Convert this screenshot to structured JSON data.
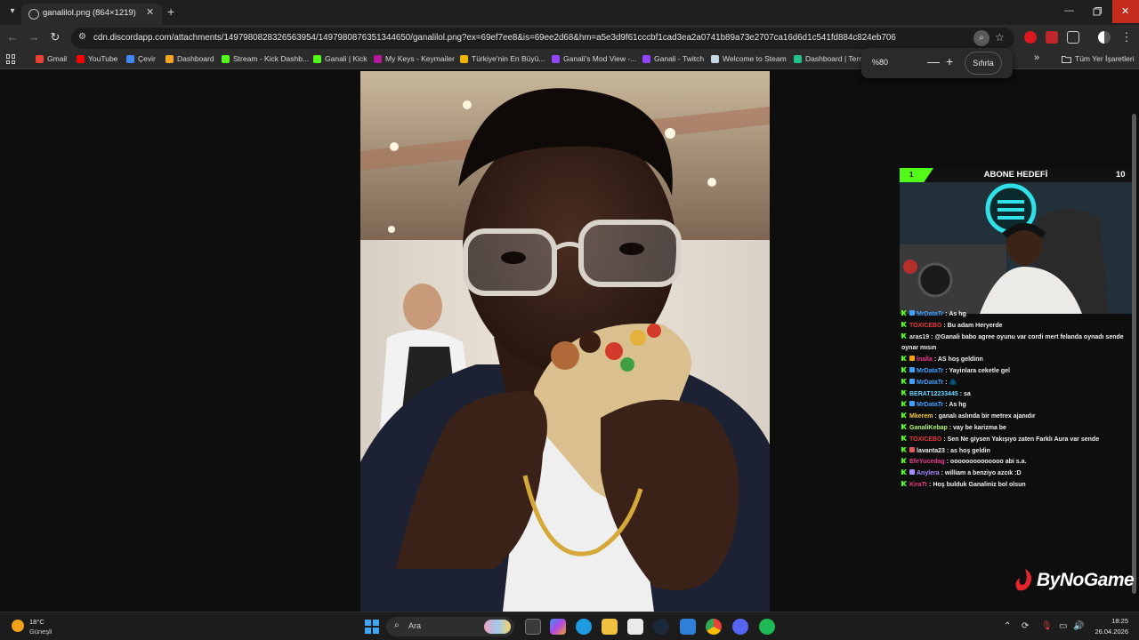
{
  "browser": {
    "tab_title": "ganalilol.png (864×1219)",
    "tab_close": "✕",
    "new_tab": "+",
    "url": "cdn.discordapp.com/attachments/1497980828326563954/1497980876351344650/ganalilol.png?ex=69ef7ee8&is=69ee2d68&hm=a5e3d9f61cccbf1cad3ea2a0741b89a73e2707ca16d6d1c541fd884c824eb706",
    "window_controls": {
      "minimize": "—",
      "close": "✕"
    }
  },
  "bookmarks": [
    {
      "label": "Gmail",
      "color": "#ea4335"
    },
    {
      "label": "YouTube",
      "color": "#ff0000"
    },
    {
      "label": "Çevir",
      "color": "#4285f4"
    },
    {
      "label": "Dashboard",
      "color": "#f6a623"
    },
    {
      "label": "Stream - Kick Dashb...",
      "color": "#53fc18"
    },
    {
      "label": "Ganali | Kick",
      "color": "#53fc18"
    },
    {
      "label": "My Keys - Keymailer",
      "color": "#b5179e"
    },
    {
      "label": "Türkiye'nin En Büyü...",
      "color": "#f0b400"
    },
    {
      "label": "Ganali's Mod View -...",
      "color": "#9146ff"
    },
    {
      "label": "Ganali - Twitch",
      "color": "#9146ff"
    },
    {
      "label": "Welcome to Steam",
      "color": "#c7d5e0"
    },
    {
      "label": "Dashboard | Term",
      "color": "#24c28a"
    }
  ],
  "bookmarks_overflow": "»",
  "all_bookmarks": "Tüm Yer İşaretleri",
  "zoom_popup": {
    "level": "%80",
    "minus": "—",
    "plus": "+",
    "reset": "Sıfırla"
  },
  "overlay": {
    "goal_title": "ABONE HEDEFİ",
    "goal_current": "1",
    "goal_target": "10",
    "goal_progress": 0.1,
    "accent": "#53fc18"
  },
  "chat": [
    {
      "user": "MrDataTr",
      "user_color": "#3fa0ff",
      "badge": "#3fa0ff",
      "message": "As hg"
    },
    {
      "user": "TOXICEBO",
      "user_color": "#e83a3a",
      "badge": "",
      "message": "Bu adam Heryerde"
    },
    {
      "user": "aras19",
      "user_color": "#e0e0e0",
      "badge": "",
      "message": "@Ganali babo agree oyunu var cordi mert felanda oynadı sende oynar mısın"
    },
    {
      "user": "İnaİla",
      "user_color": "#e83a8a",
      "badge": "#f4a11a",
      "message": "AS hoş geldinn"
    },
    {
      "user": "MrDataTr",
      "user_color": "#3fa0ff",
      "badge": "#3fa0ff",
      "message": "Yayinlara ceketle gel"
    },
    {
      "user": "MrDataTr",
      "user_color": "#3fa0ff",
      "badge": "#3fa0ff",
      "message": "🧥"
    },
    {
      "user": "BERAT12233445",
      "user_color": "#6fd3ff",
      "badge": "",
      "message": "sa"
    },
    {
      "user": "MrDataTr",
      "user_color": "#3fa0ff",
      "badge": "#3fa0ff",
      "message": "As hg"
    },
    {
      "user": "Mkerem",
      "user_color": "#f7c948",
      "badge": "",
      "message": "ganalı aslında bir metrex ajanıdır"
    },
    {
      "user": "GanaliKebap",
      "user_color": "#b6f26b",
      "badge": "",
      "message": "vay be karizma be"
    },
    {
      "user": "TOXICEBO",
      "user_color": "#e83a3a",
      "badge": "",
      "message": "Sen Ne giysen Yakışıyo zaten Farklı Aura var sende"
    },
    {
      "user": "lavanta23",
      "user_color": "#f0f0f0",
      "badge": "#e05a5a",
      "message": "as hoş geldin"
    },
    {
      "user": "EfeYucedag",
      "user_color": "#e83a8a",
      "badge": "",
      "message": "oooooooooooooo abi s.a."
    },
    {
      "user": "Anylera",
      "user_color": "#a88bff",
      "badge": "#a88bff",
      "message": "william a benziyo azcık :D"
    },
    {
      "user": "KiraTr",
      "user_color": "#e83a8a",
      "badge": "",
      "message": "Hoş bulduk Ganaliniz bol olsun"
    }
  ],
  "bynogame": "ByNoGame",
  "taskbar": {
    "weather_temp": "18°C",
    "weather_desc": "Güneşli",
    "search_label": "Ara",
    "time": "18:25",
    "date": "26.04.2026"
  }
}
